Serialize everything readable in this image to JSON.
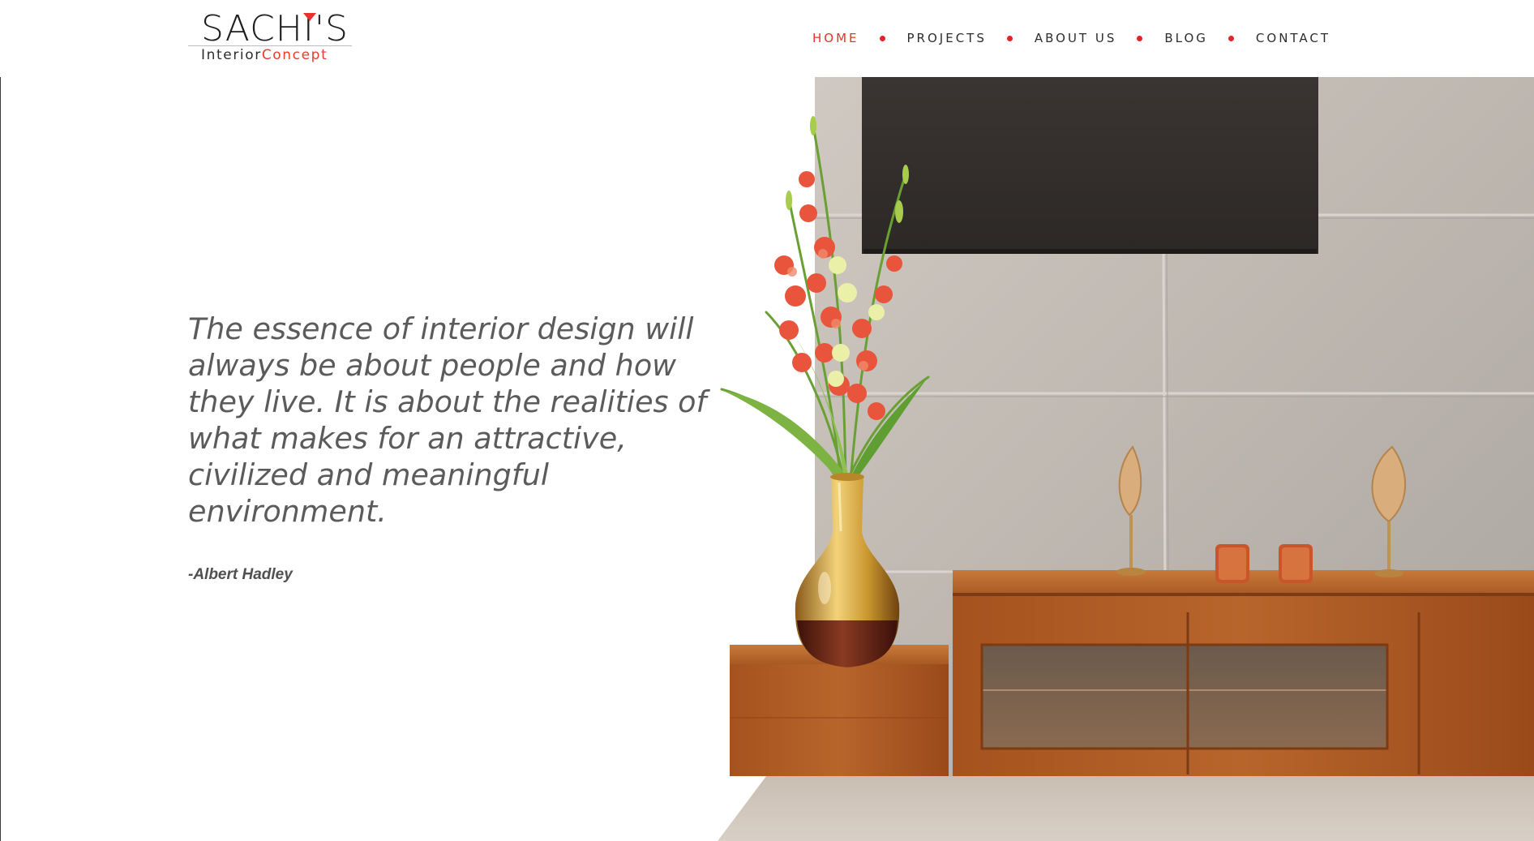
{
  "brand": {
    "name": "SACHI'S",
    "sub_first": "Interior",
    "sub_second": "Concept",
    "accent": "#e8322a"
  },
  "nav": {
    "items": [
      {
        "label": "HOME",
        "active": true
      },
      {
        "label": "PROJECTS",
        "active": false
      },
      {
        "label": "ABOUT US",
        "active": false
      },
      {
        "label": "BLOG",
        "active": false
      },
      {
        "label": "CONTACT",
        "active": false
      }
    ],
    "separator_icon": "dot-icon"
  },
  "hero": {
    "quote": "The essence of interior design will always be about people and how they live. It is about the realities of what makes for an attractive, civilized and meaningful environment.",
    "author": "-Albert Hadley",
    "image": "living-room-tv-console-photo"
  }
}
